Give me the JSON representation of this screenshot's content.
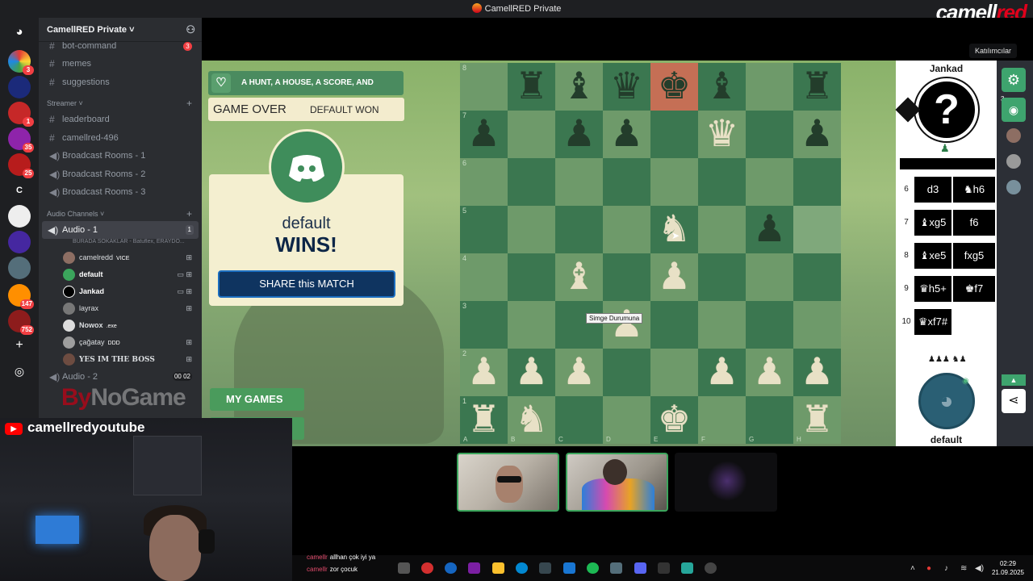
{
  "window": {
    "title": "CamellRED Private",
    "watermark_a": "camell",
    "watermark_b": "red"
  },
  "server_rail": {
    "badges": [
      "3",
      "1",
      "35",
      "25",
      "147",
      "752"
    ],
    "letter_server": "C"
  },
  "sidebar": {
    "server_name": "CamellRED Private",
    "text_channels": [
      {
        "name": "bot-command",
        "count": "3"
      },
      {
        "name": "memes"
      },
      {
        "name": "suggestions"
      }
    ],
    "streamer_category": "Streamer",
    "streamer_channels": [
      {
        "name": "leaderboard",
        "type": "text"
      },
      {
        "name": "camellred-496",
        "type": "text"
      },
      {
        "name": "Broadcast Rooms - 1",
        "type": "voice"
      },
      {
        "name": "Broadcast Rooms - 2",
        "type": "voice"
      },
      {
        "name": "Broadcast Rooms - 3",
        "type": "voice"
      }
    ],
    "audio_category": "Audio Channels",
    "active_voice": {
      "name": "Audio - 1",
      "limit": "1",
      "activity": "BURADA SOKAKLAR - Batuflex, ERAYDO..."
    },
    "members": [
      {
        "name": "camelredd",
        "tag": "VICE"
      },
      {
        "name": "default",
        "tag": ""
      },
      {
        "name": "Jankad",
        "tag": ""
      },
      {
        "name": "layrax",
        "tag": ""
      },
      {
        "name": "Nowox",
        "tag": ".exe"
      },
      {
        "name": "çağatay",
        "tag": "DDD"
      },
      {
        "name": "YES IM THE BOSS",
        "tag": ""
      }
    ],
    "next_voice": {
      "name": "Audio - 2",
      "counts": "00 02"
    }
  },
  "game": {
    "title": "A HUNT, A HOUSE, A SCORE, AND JANKAD",
    "status": "GAME OVER",
    "status_detail": "DEFAULT WON",
    "winner_name": "default",
    "winner_text": "WINS!",
    "share_label": "SHARE this MATCH",
    "my_games_label": "MY GAMES",
    "tooltip": "Simge Durumuna"
  },
  "board": {
    "ranks": [
      "8",
      "7",
      "6",
      "5",
      "4",
      "3",
      "2",
      "1"
    ],
    "files": [
      "A",
      "B",
      "C",
      "D",
      "E",
      "F",
      "G",
      "H"
    ],
    "rows": [
      [
        "",
        "bR",
        "bB",
        "bQ",
        "bK*",
        "bB",
        "",
        "bR"
      ],
      [
        "bP",
        "",
        "bP",
        "bP",
        "",
        "wQ",
        "",
        "bP"
      ],
      [
        "",
        "",
        "",
        "",
        "",
        "",
        "",
        ""
      ],
      [
        "",
        "",
        "",
        "",
        "wN",
        "",
        "bP",
        "~"
      ],
      [
        "",
        "",
        "wB",
        "",
        "wP",
        "",
        "",
        ""
      ],
      [
        "",
        "",
        "",
        "wP",
        "",
        "",
        "",
        ""
      ],
      [
        "wP",
        "wP",
        "wP",
        "",
        "",
        "wP",
        "wP",
        "wP"
      ],
      [
        "wR",
        "wN",
        "",
        "",
        "wK",
        "",
        "",
        "wR"
      ]
    ]
  },
  "panel": {
    "opponent": "Jankad",
    "me": "default",
    "moves": [
      {
        "n": "6",
        "w": "d3",
        "b": "♞h6"
      },
      {
        "n": "7",
        "w": "♝xg5",
        "b": "f6"
      },
      {
        "n": "8",
        "w": "♝xe5",
        "b": "fxg5"
      },
      {
        "n": "9",
        "w": "♛h5+",
        "b": "♚f7"
      },
      {
        "n": "10",
        "w": "♛xf7#",
        "b": ""
      }
    ],
    "participant_count": "3",
    "tooltip": "Katılımcılar"
  },
  "stream": {
    "channel": "camellredyoutube",
    "sponsor_a": "By",
    "sponsor_b": "NoGame",
    "chat": [
      {
        "user": "camellr",
        "text": "allhan çok iyi ya"
      },
      {
        "user": "camellr",
        "text": "zor çocuk"
      }
    ]
  },
  "taskbar": {
    "time": "02:29",
    "date": "21.09.2025"
  }
}
